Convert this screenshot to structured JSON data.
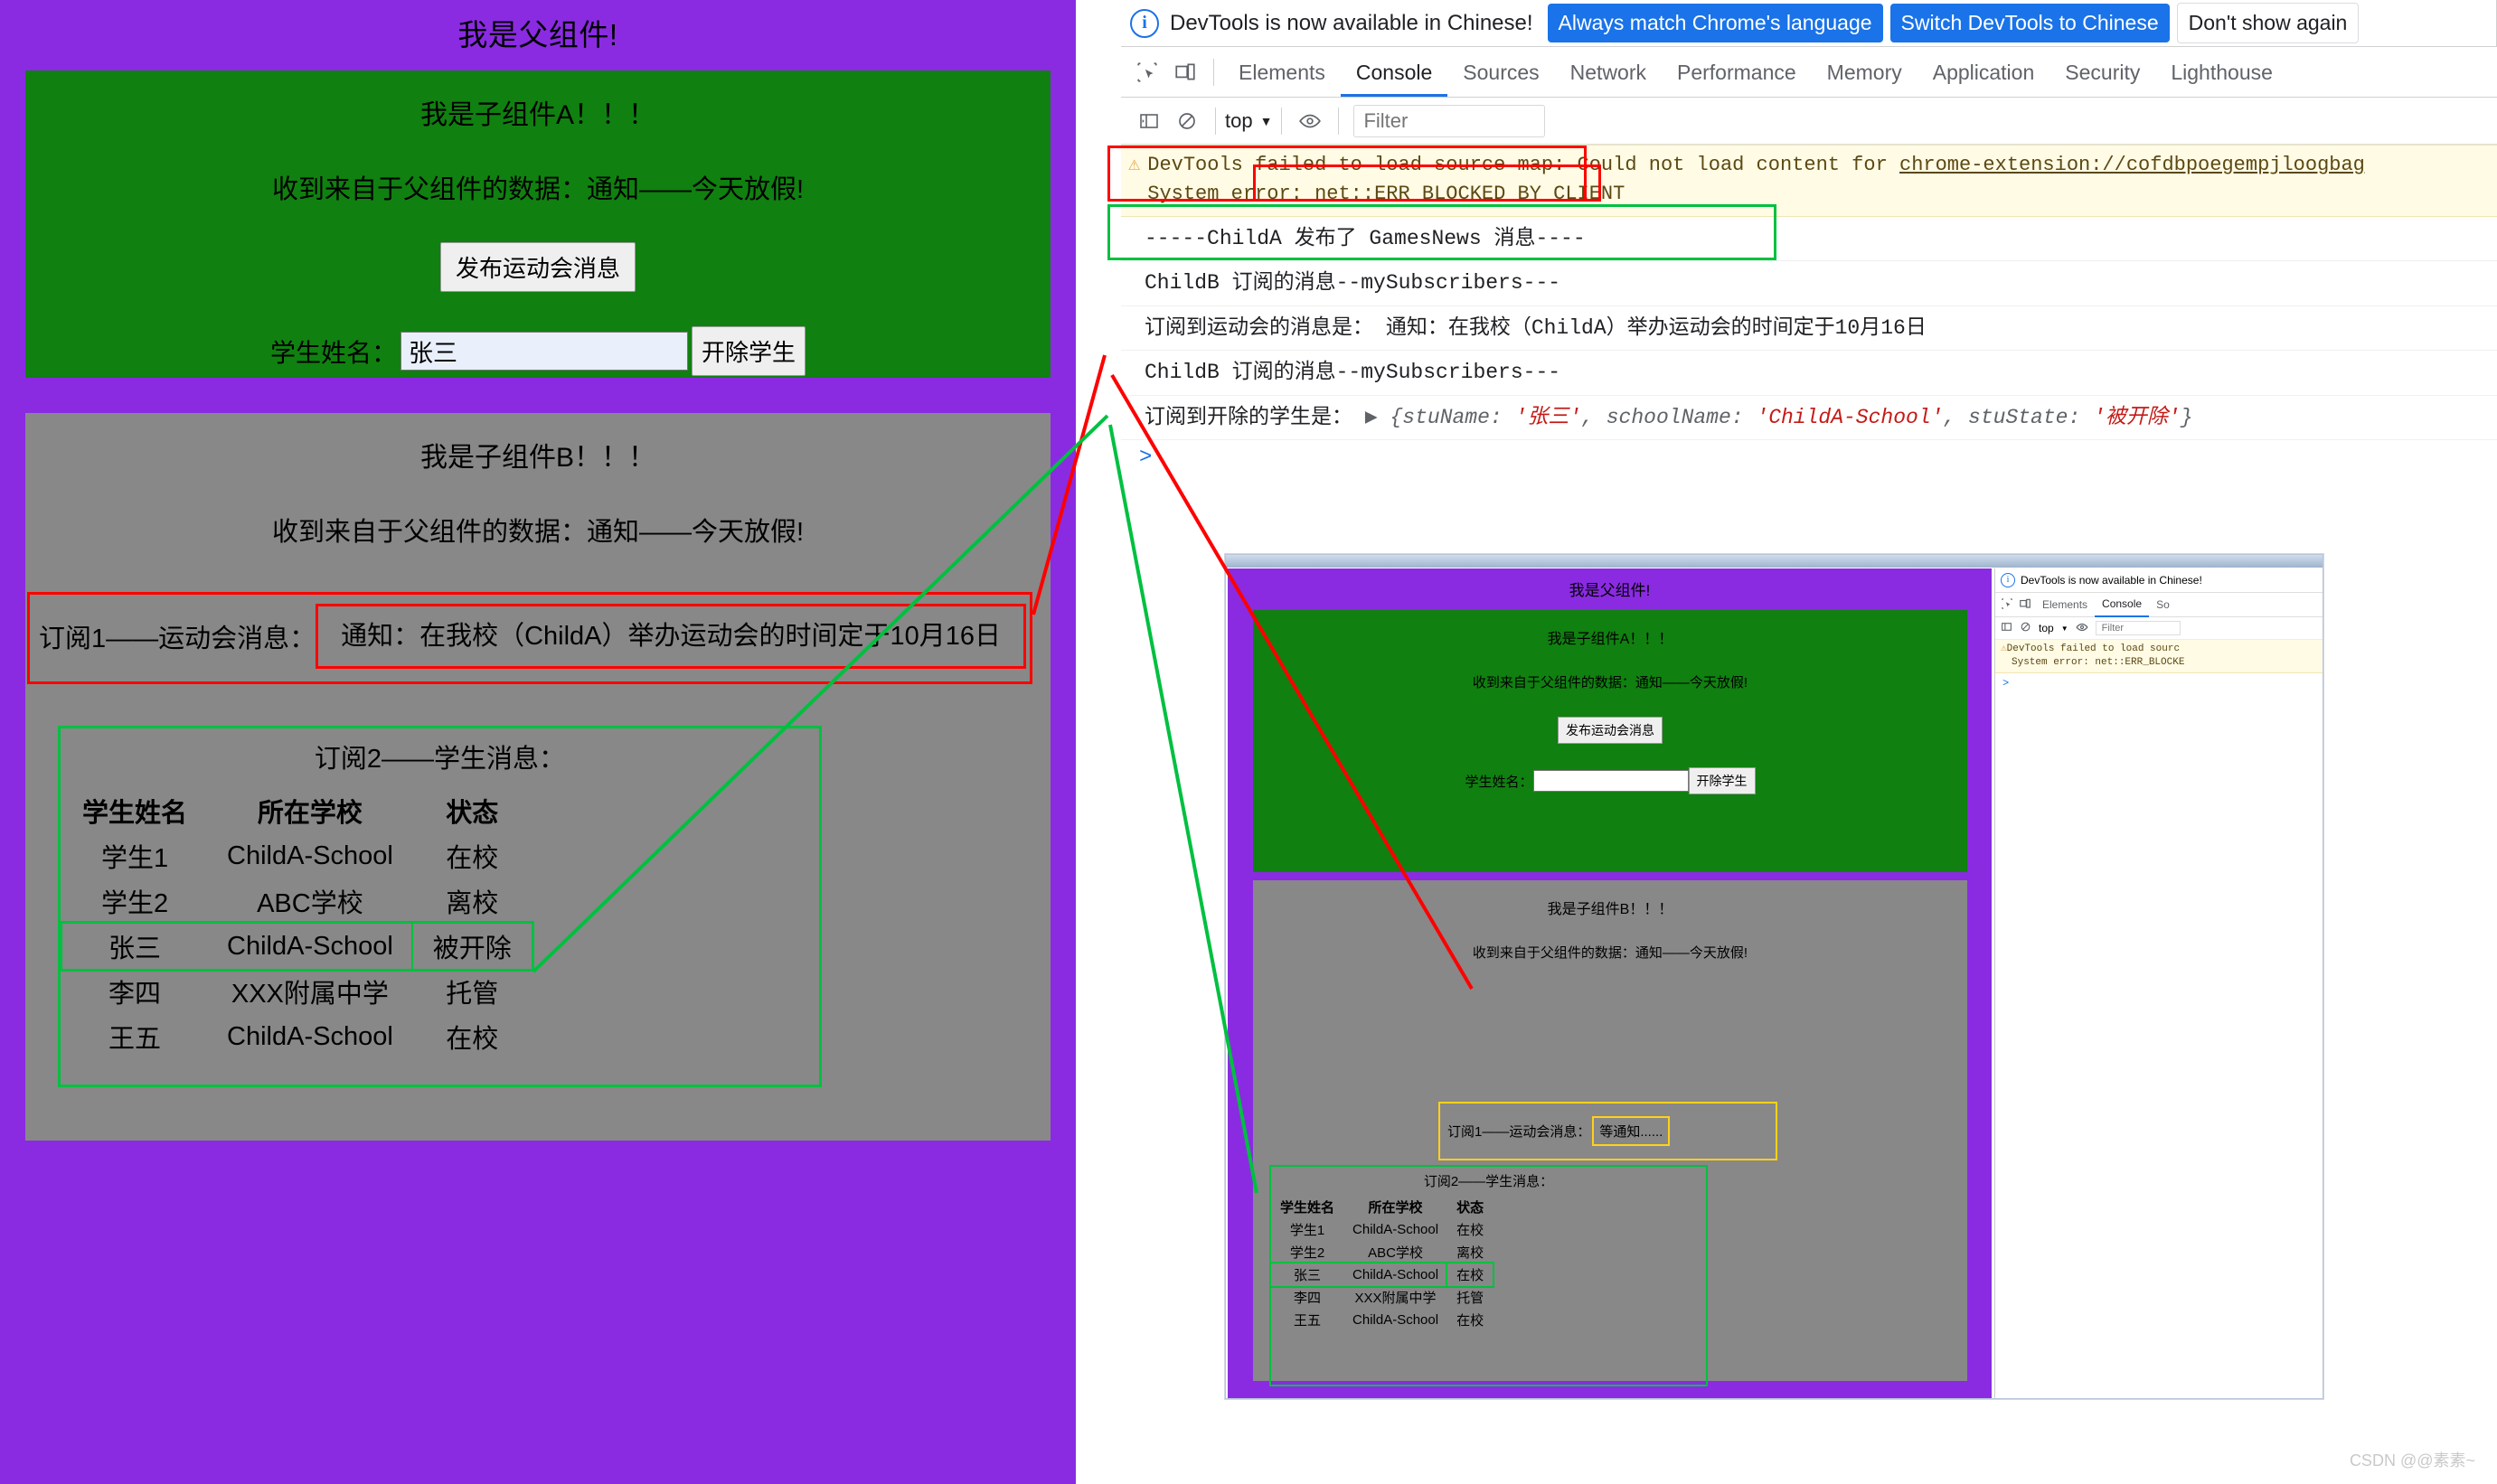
{
  "left_app": {
    "parent_title": "我是父组件!",
    "child_a": {
      "heading": "我是子组件A！！！",
      "received": "收到来自于父组件的数据：通知——今天放假!",
      "publish_button": "发布运动会消息",
      "name_label": "学生姓名：",
      "name_value": "张三",
      "expel_button": "开除学生"
    },
    "child_b": {
      "heading": "我是子组件B！！！",
      "received": "收到来自于父组件的数据：通知——今天放假!",
      "sub1_label": "订阅1——运动会消息：",
      "sub1_value": "通知：在我校（ChildA）举办运动会的时间定于10月16日",
      "sub2_title": "订阅2——学生消息：",
      "table": {
        "headers": [
          "学生姓名",
          "所在学校",
          "状态"
        ],
        "rows": [
          {
            "name": "学生1",
            "school": "ChildA-School",
            "state": "在校",
            "highlight": false
          },
          {
            "name": "学生2",
            "school": "ABC学校",
            "state": "离校",
            "highlight": false
          },
          {
            "name": "张三",
            "school": "ChildA-School",
            "state": "被开除",
            "highlight": true
          },
          {
            "name": "李四",
            "school": "XXX附属中学",
            "state": "托管",
            "highlight": false
          },
          {
            "name": "王五",
            "school": "ChildA-School",
            "state": "在校",
            "highlight": false
          }
        ]
      }
    },
    "colors": {
      "parent_bg": "#8a2be2",
      "child_a_bg": "#108010",
      "child_b_bg": "#888888"
    }
  },
  "devtools": {
    "banner": {
      "message": "DevTools is now available in Chinese!",
      "btn_always": "Always match Chrome's language",
      "btn_switch": "Switch DevTools to Chinese",
      "btn_dismiss": "Don't show again",
      "info_glyph": "i"
    },
    "tabs": [
      {
        "label": "Elements",
        "active": false
      },
      {
        "label": "Console",
        "active": true
      },
      {
        "label": "Sources",
        "active": false
      },
      {
        "label": "Network",
        "active": false
      },
      {
        "label": "Performance",
        "active": false
      },
      {
        "label": "Memory",
        "active": false
      },
      {
        "label": "Application",
        "active": false
      },
      {
        "label": "Security",
        "active": false
      },
      {
        "label": "Lighthouse",
        "active": false
      }
    ],
    "toolbar": {
      "context": "top",
      "filter_placeholder": "Filter",
      "caret": "▼"
    },
    "console": {
      "warning": {
        "icon": "⚠",
        "line1_before": "DevTools failed to load source map: Could not load content for ",
        "link": "chrome-extension://cofdbpoegempjloogbag",
        "line2": "System error: net::ERR_BLOCKED_BY_CLIENT"
      },
      "rows": [
        "-----ChildA 发布了 GamesNews 消息----",
        "ChildB 订阅的消息--mySubscribers---",
        "订阅到运动会的消息是：",
        "ChildB 订阅的消息--mySubscribers---",
        "订阅到开除的学生是："
      ],
      "games_value": "通知：在我校（ChildA）举办运动会的时间定于10月16日",
      "object": {
        "triangle": "▶",
        "open": "{",
        "k1": "stuName",
        "v1": "'张三'",
        "k2": "schoolName",
        "v2": "'ChildA-School'",
        "k3": "stuState",
        "v3": "'被开除'",
        "close": "}",
        "sep": ", ",
        "colon": ": "
      },
      "prompt": ">"
    }
  },
  "nested_screenshot": {
    "page": {
      "parent_title": "我是父组件!",
      "child_a": {
        "heading": "我是子组件A！！！",
        "received": "收到来自于父组件的数据：通知——今天放假!",
        "publish_button": "发布运动会消息",
        "name_label": "学生姓名：",
        "name_value": "",
        "expel_button": "开除学生"
      },
      "child_b": {
        "heading": "我是子组件B！！！",
        "received": "收到来自于父组件的数据：通知——今天放假!",
        "sub1_label": "订阅1——运动会消息：",
        "sub1_value": "等通知......",
        "sub2_title": "订阅2——学生消息：",
        "table": {
          "headers": [
            "学生姓名",
            "所在学校",
            "状态"
          ],
          "rows": [
            {
              "name": "学生1",
              "school": "ChildA-School",
              "state": "在校",
              "highlight": false
            },
            {
              "name": "学生2",
              "school": "ABC学校",
              "state": "离校",
              "highlight": false
            },
            {
              "name": "张三",
              "school": "ChildA-School",
              "state": "在校",
              "highlight": true
            },
            {
              "name": "李四",
              "school": "XXX附属中学",
              "state": "托管",
              "highlight": false
            },
            {
              "name": "王五",
              "school": "ChildA-School",
              "state": "在校",
              "highlight": false
            }
          ]
        }
      }
    },
    "devtools": {
      "banner_message": "DevTools is now available in Chinese!",
      "tabs": [
        "Elements",
        "Console",
        "So"
      ],
      "active_tab": "Console",
      "context": "top",
      "filter_placeholder": "Filter",
      "warn_line1": "DevTools failed to load sourc",
      "warn_line2": "System error: net::ERR_BLOCKE",
      "prompt": ">"
    }
  },
  "watermark": "CSDN @@素素~"
}
